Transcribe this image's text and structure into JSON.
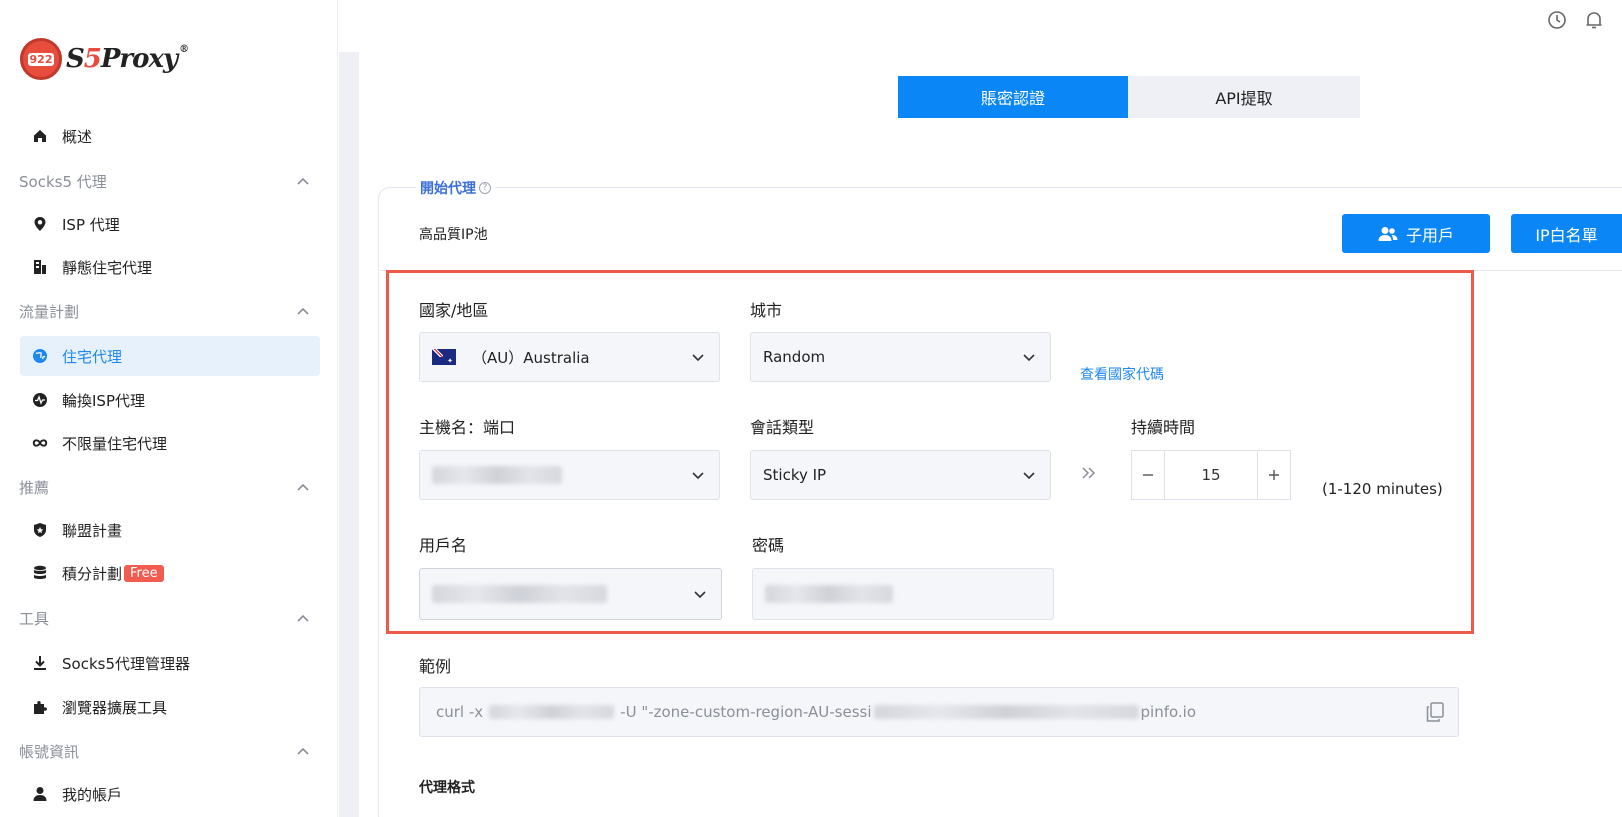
{
  "logo": {
    "prefix": "922",
    "brand_a": "S",
    "brand_five": "5",
    "brand_b": "Proxy",
    "reg": "®"
  },
  "sidebar": {
    "overview": "概述",
    "sec_socks5": "Socks5 代理",
    "isp": "ISP 代理",
    "static_res": "靜態住宅代理",
    "sec_traffic": "流量計劃",
    "residential": "住宅代理",
    "rotating_isp": "輪換ISP代理",
    "unlimited": "不限量住宅代理",
    "sec_recommend": "推薦",
    "affiliate": "聯盟計畫",
    "points": "積分計劃",
    "free_badge": "Free",
    "sec_tools": "工具",
    "socks_manager": "Socks5代理管理器",
    "browser_ext": "瀏覽器擴展工具",
    "sec_account": "帳號資訊",
    "my_account": "我的帳戶"
  },
  "tabs": {
    "account_auth": "賬密認證",
    "api": "API提取"
  },
  "panel": {
    "legend": "開始代理",
    "pool": "高品質IP池",
    "sub_user_btn": "子用戶",
    "whitelist_btn": "IP白名單"
  },
  "form": {
    "country_label": "國家/地區",
    "country_value": "（AU）Australia",
    "city_label": "城市",
    "city_value": "Random",
    "country_code_link": "查看國家代碼",
    "host_label": "主機名：端口",
    "session_label": "會話類型",
    "session_value": "Sticky IP",
    "duration_label": "持續時間",
    "duration_value": "15",
    "duration_range": "(1-120 minutes)",
    "username_label": "用戶名",
    "password_label": "密碼"
  },
  "example": {
    "label": "範例",
    "part1": "curl -x",
    "part2": "-U \"-zone-custom-region-AU-sessi",
    "part3": "pinfo.io"
  },
  "format_label": "代理格式"
}
